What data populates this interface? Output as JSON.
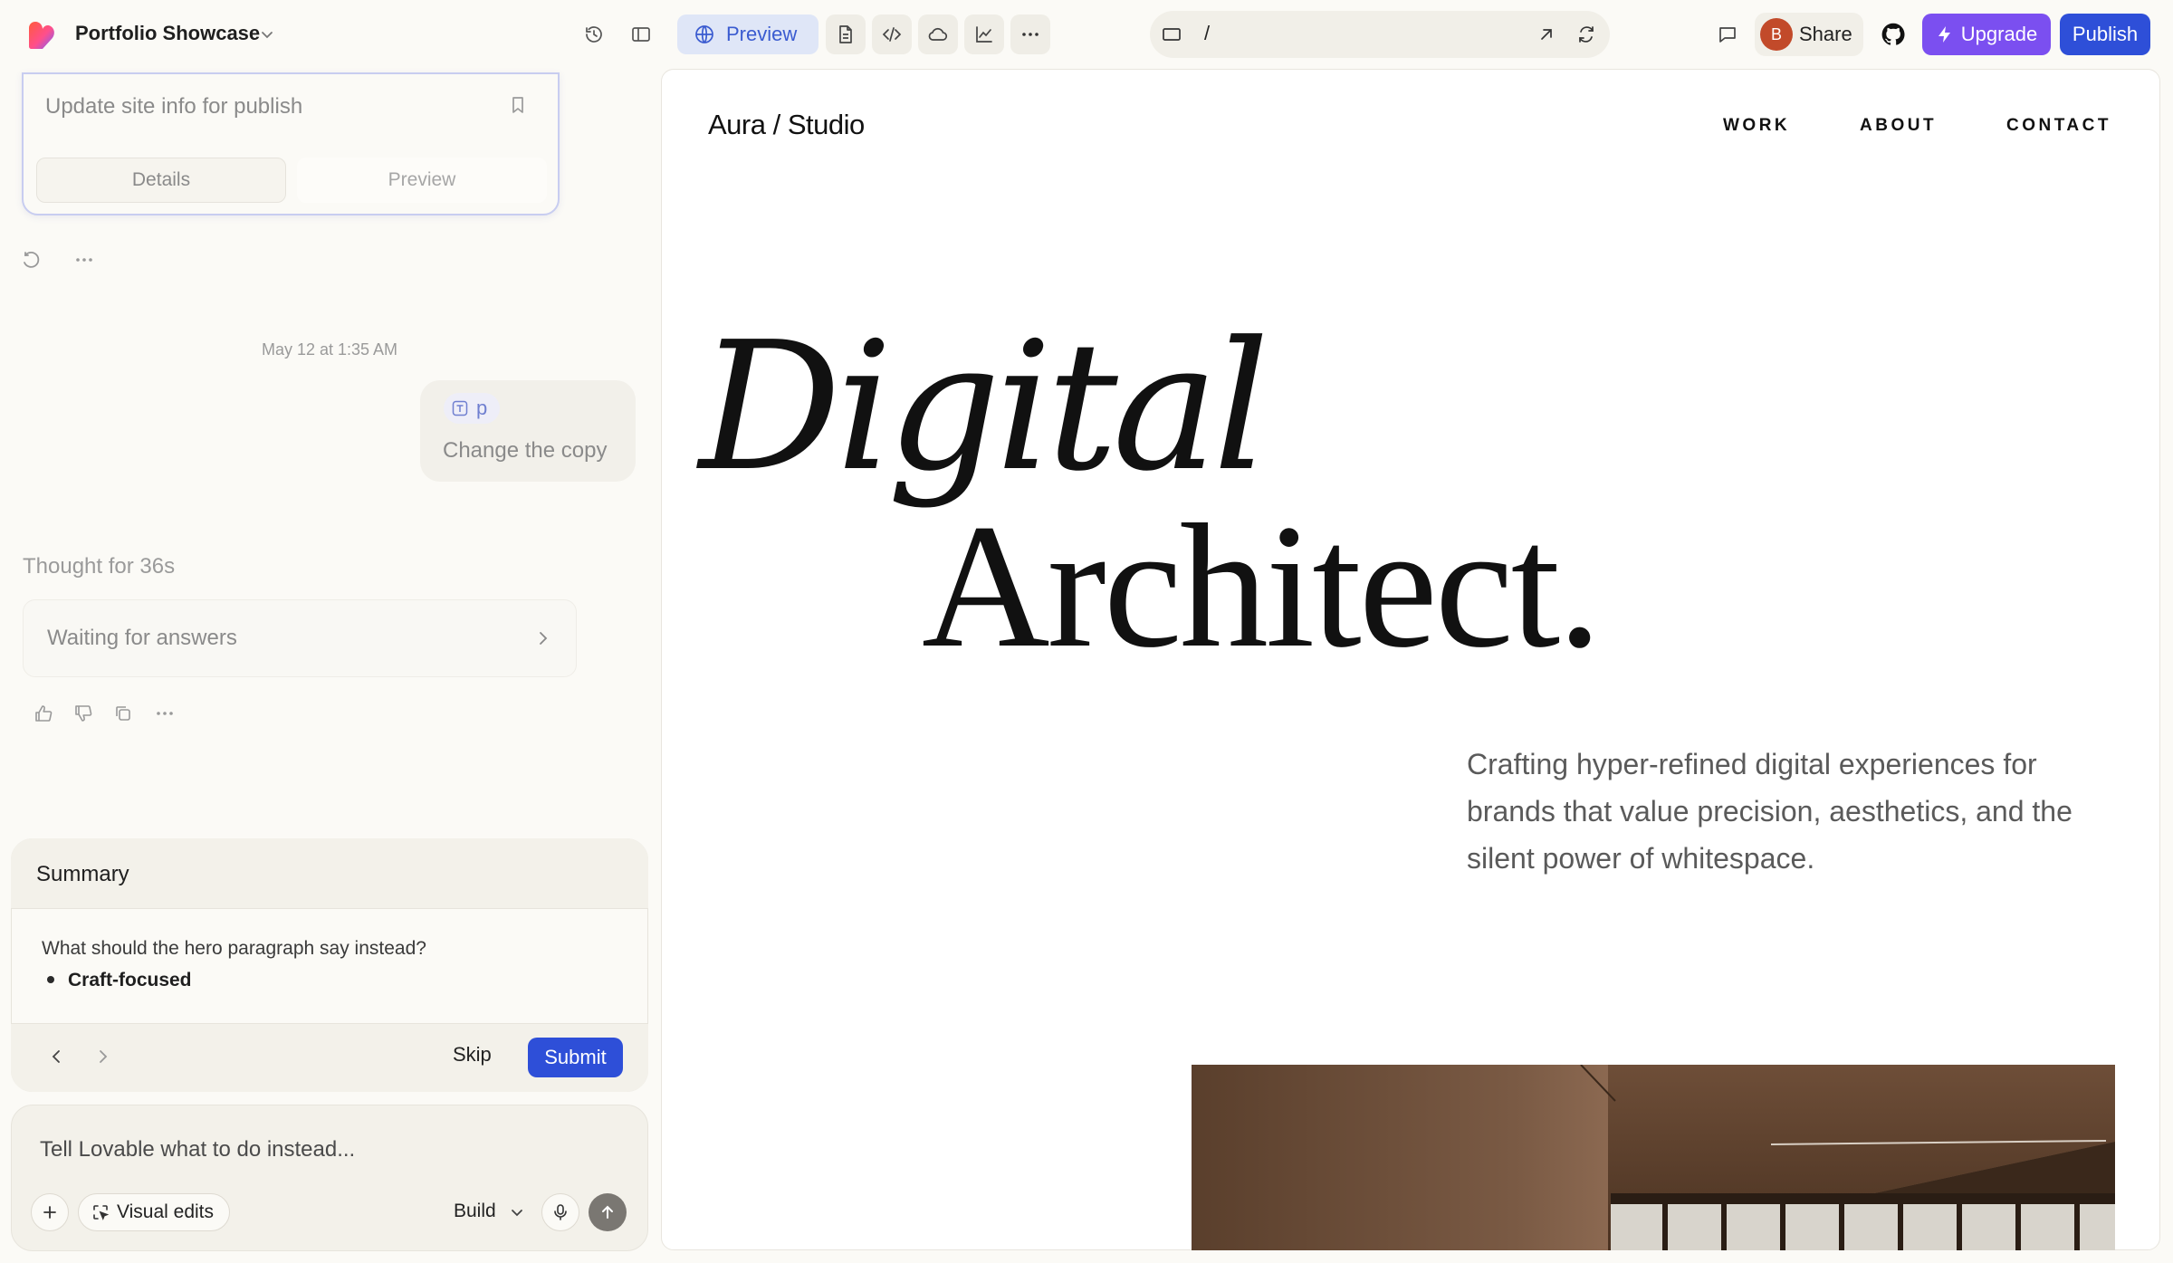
{
  "topbar": {
    "project_name": "Portfolio Showcase",
    "preview_label": "Preview",
    "url_path": "/",
    "avatar_initial": "B",
    "share_label": "Share",
    "upgrade_label": "Upgrade",
    "publish_label": "Publish",
    "accent_color": "#2e4fd8",
    "upgrade_color": "#7b4ff0"
  },
  "chat": {
    "task_card": {
      "title": "Update site info for publish",
      "tabs": [
        "Details",
        "Preview"
      ]
    },
    "timestamp": "May 12 at 1:35 AM",
    "user_message": {
      "mention": "p",
      "text": "Change the copy"
    },
    "thought": "Thought for 36s",
    "waiting_card": "Waiting for answers",
    "summary": {
      "title": "Summary",
      "question": "What should the hero paragraph say instead?",
      "answer": "Craft-focused",
      "skip_label": "Skip",
      "submit_label": "Submit"
    },
    "composer": {
      "placeholder": "Tell Lovable what to do instead...",
      "visual_edits_label": "Visual edits",
      "mode_label": "Build"
    }
  },
  "site": {
    "logo": "Aura / Studio",
    "nav": [
      "WORK",
      "ABOUT",
      "CONTACT"
    ],
    "hero_line_1": "Digital",
    "hero_line_2": "Architect.",
    "hero_paragraph": "Crafting hyper-refined digital experiences for brands that value precision, aesthetics, and the silent power of whitespace."
  }
}
